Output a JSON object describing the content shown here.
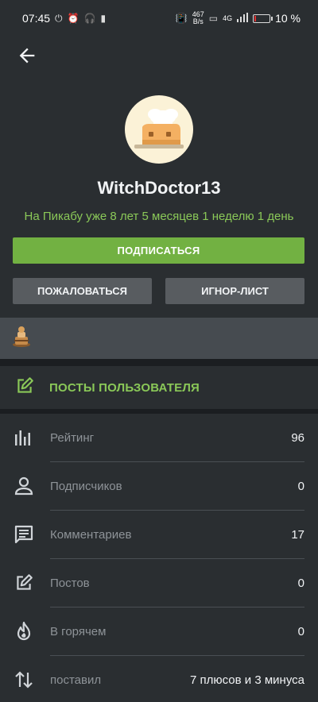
{
  "status_bar": {
    "time": "07:45",
    "net_speed_value": "467",
    "net_speed_unit": "B/s",
    "network_type": "4G",
    "battery_percent": "10 %",
    "battery_level": 0.1
  },
  "profile": {
    "back_icon": "arrow-left-icon",
    "username": "WitchDoctor13",
    "since": "На Пикабу уже 8 лет 5 месяцев 1 неделю 1 день"
  },
  "actions": {
    "subscribe": "ПОДПИСАТЬСЯ",
    "report": "ПОЖАЛОВАТЬСЯ",
    "ignore": "ИГНОР-ЛИСТ"
  },
  "posts": {
    "label": "ПОСТЫ ПОЛЬЗОВАТЕЛЯ",
    "icon": "edit-icon"
  },
  "stats": [
    {
      "icon": "bar-chart-icon",
      "label": "Рейтинг",
      "value": "96"
    },
    {
      "icon": "person-icon",
      "label": "Подписчиков",
      "value": "0"
    },
    {
      "icon": "comment-icon",
      "label": "Комментариев",
      "value": "17"
    },
    {
      "icon": "edit-icon",
      "label": "Постов",
      "value": "0"
    },
    {
      "icon": "fire-icon",
      "label": "В горячем",
      "value": "0"
    },
    {
      "icon": "sort-arrows-icon",
      "label": "поставил",
      "value": "7 плюсов и 3 минуса"
    }
  ],
  "colors": {
    "accent_green": "#72b142",
    "text_green": "#8ac858",
    "background": "#2a2e31"
  }
}
